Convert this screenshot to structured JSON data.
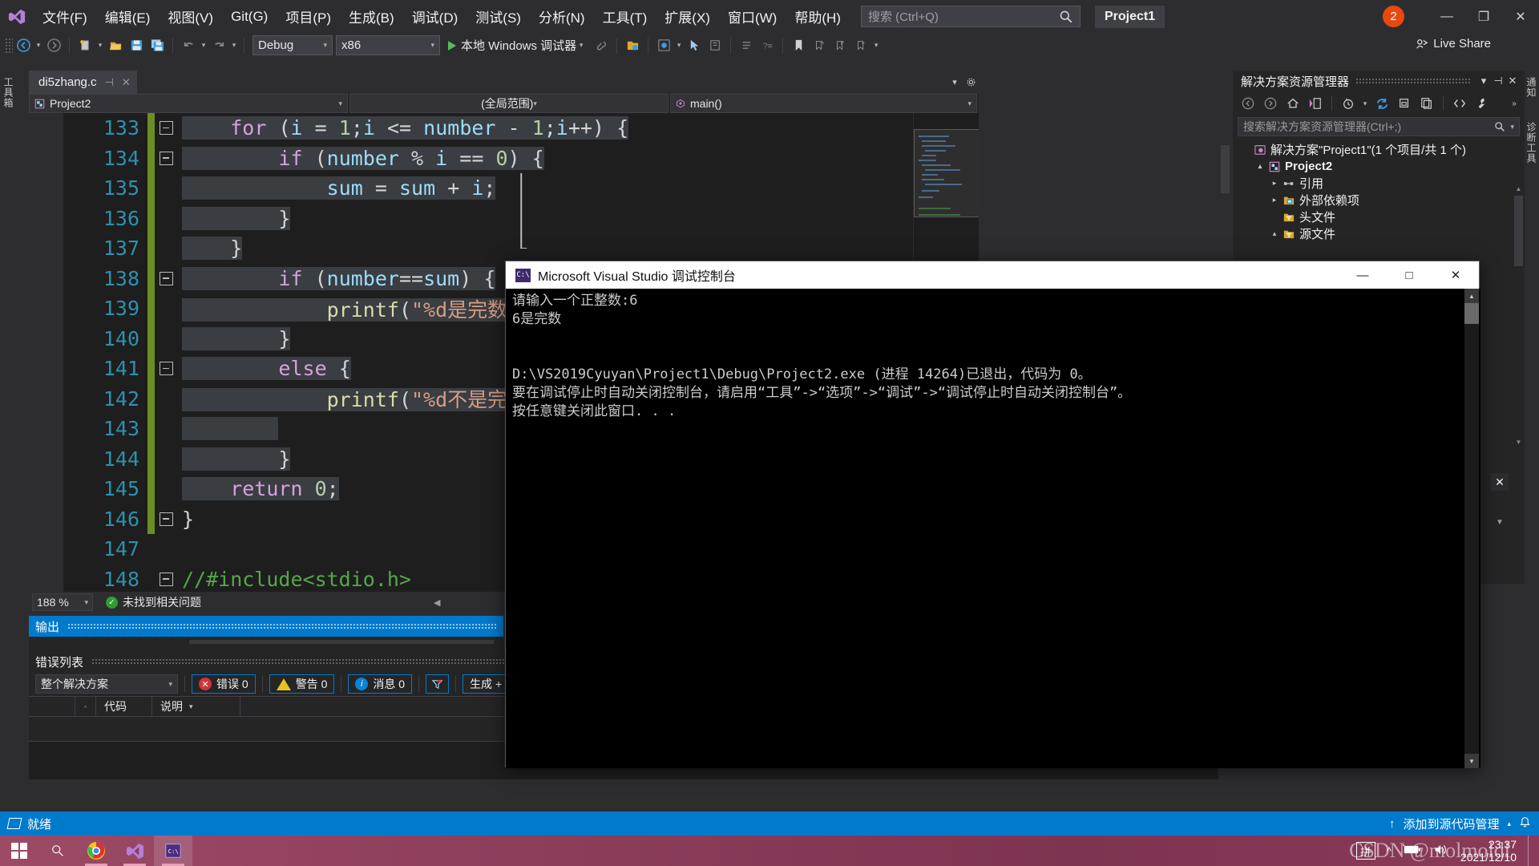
{
  "titlebar": {
    "menus": [
      {
        "label": "文件(F)"
      },
      {
        "label": "编辑(E)"
      },
      {
        "label": "视图(V)"
      },
      {
        "label": "Git(G)"
      },
      {
        "label": "项目(P)"
      },
      {
        "label": "生成(B)"
      },
      {
        "label": "调试(D)"
      },
      {
        "label": "测试(S)"
      },
      {
        "label": "分析(N)"
      },
      {
        "label": "工具(T)"
      },
      {
        "label": "扩展(X)"
      },
      {
        "label": "窗口(W)"
      },
      {
        "label": "帮助(H)"
      }
    ],
    "search_placeholder": "搜索 (Ctrl+Q)",
    "project_badge": "Project1",
    "notification_count": "2",
    "minimize": "—",
    "restore": "❐",
    "close": "✕"
  },
  "toolbar": {
    "config": "Debug",
    "platform": "x86",
    "run_label": "本地 Windows 调试器",
    "live_share": "Live Share"
  },
  "left_rail": {
    "label": "工具箱"
  },
  "right_rail": {
    "labels": [
      "通知",
      "诊断工具"
    ]
  },
  "editor": {
    "tab_name": "di5zhang.c",
    "tab_pin": "⊣",
    "tab_close": "✕",
    "nav_project": "Project2",
    "nav_scope": "(全局范围)",
    "nav_member": "main()",
    "zoom": "188 %",
    "issue_status": "未找到相关问题",
    "lines": [
      {
        "n": "133",
        "modified": true,
        "fold": "box",
        "html": "<span class=\"sel\">    <span class=\"kw\">for</span> <span class=\"pun\">(</span><span class=\"idf\">i</span> <span class=\"pun\">=</span> <span class=\"num\">1</span><span class=\"pun\">;</span><span class=\"idf\">i</span> <span class=\"pun\">&lt;=</span> <span class=\"idf\">number</span> <span class=\"pun\">-</span> <span class=\"num\">1</span><span class=\"pun\">;</span><span class=\"idf\">i</span><span class=\"pun\">++)</span> <span class=\"pun\">{</span></span>"
      },
      {
        "n": "134",
        "modified": true,
        "fold": "box",
        "html": "<span class=\"sel\">        <span class=\"kw\">if</span> <span class=\"pun\">(</span><span class=\"idf\">number</span> <span class=\"pun\">%</span> <span class=\"idf\">i</span> <span class=\"pun\">==</span> <span class=\"num\">0</span><span class=\"pun\">)</span> <span class=\"pun\">{</span></span>"
      },
      {
        "n": "135",
        "modified": true,
        "fold": "line",
        "html": "<span class=\"sel\">            <span class=\"idf\">sum</span> <span class=\"pun\">=</span> <span class=\"idf\">sum</span> <span class=\"pun\">+</span> <span class=\"idf\">i</span><span class=\"pun\">;</span></span>"
      },
      {
        "n": "136",
        "modified": true,
        "fold": "line",
        "html": "<span class=\"sel\">        <span class=\"pun\">}</span></span>"
      },
      {
        "n": "137",
        "modified": true,
        "fold": "corner",
        "html": "<span class=\"sel\">    <span class=\"pun\">}</span></span>"
      },
      {
        "n": "138",
        "modified": true,
        "fold": "box",
        "html": "<span class=\"sel\">        <span class=\"kw\">if</span> <span class=\"pun\">(</span><span class=\"idf\">number</span><span class=\"pun\">==</span><span class=\"idf\">sum</span><span class=\"pun\">)</span> <span class=\"pun\">{</span></span>"
      },
      {
        "n": "139",
        "modified": true,
        "fold": "line",
        "html": "<span class=\"sel\">            <span class=\"fn\">printf</span><span class=\"pun\">(</span><span class=\"str\">\"%d是完数\\n\"</span><span class=\"pun\">,</span> <span class=\"idf\">number</span><span class=\"pun\">);</span></span>"
      },
      {
        "n": "140",
        "modified": true,
        "fold": "line",
        "html": "<span class=\"sel\">        <span class=\"pun\">}</span></span>"
      },
      {
        "n": "141",
        "modified": true,
        "fold": "box",
        "html": "<span class=\"sel\">        <span class=\"kw\">else</span> <span class=\"pun\">{</span></span>"
      },
      {
        "n": "142",
        "modified": true,
        "fold": "line",
        "html": "<span class=\"sel\">            <span class=\"fn\">printf</span><span class=\"pun\">(</span><span class=\"str\">\"%d不是完数\\n\"</span><span class=\"pun\">,</span> <span class=\"idf\">number</span><span class=\"pun\">);</span></span>"
      },
      {
        "n": "143",
        "modified": true,
        "fold": "line",
        "html": "<span class=\"sel\">        </span>"
      },
      {
        "n": "144",
        "modified": true,
        "fold": "line",
        "html": "<span class=\"sel\">        <span class=\"pun\">}</span></span>"
      },
      {
        "n": "145",
        "modified": true,
        "fold": "corner",
        "html": "<span class=\"sel\">    <span class=\"kw\">return</span> <span class=\"num\">0</span><span class=\"pun\">;</span></span>"
      },
      {
        "n": "146",
        "modified": true,
        "fold": "endbox",
        "html": "<span class=\"pun\">}</span>"
      },
      {
        "n": "147",
        "modified": false,
        "fold": "none",
        "html": ""
      },
      {
        "n": "148",
        "modified": false,
        "fold": "box",
        "html": "<span class=\"cmt\">//#include&lt;stdio.h&gt;</span>"
      }
    ]
  },
  "output_panel": {
    "title": "输出"
  },
  "errorlist": {
    "title": "错误列表",
    "scope": "整个解决方案",
    "errors_label": "错误 0",
    "warnings_label": "警告 0",
    "messages_label": "消息 0",
    "filter_label": "生成 + In",
    "columns": [
      "",
      "",
      "代码",
      "说明"
    ]
  },
  "solution_explorer": {
    "title": "解决方案资源管理器",
    "caret": "▾",
    "pin": "⊣",
    "close": "✕",
    "search_placeholder": "搜索解决方案资源管理器(Ctrl+;)",
    "tree": [
      {
        "indent": 0,
        "twisty": "",
        "icon": "solution",
        "label": "解决方案\"Project1\"(1 个项目/共 1 个)",
        "bold": false
      },
      {
        "indent": 1,
        "twisty": "▴",
        "icon": "project",
        "label": "Project2",
        "bold": true
      },
      {
        "indent": 2,
        "twisty": "▸",
        "icon": "reference",
        "label": "引用",
        "bold": false
      },
      {
        "indent": 2,
        "twisty": "▸",
        "icon": "folder-blue",
        "label": "外部依赖项",
        "bold": false
      },
      {
        "indent": 2,
        "twisty": "",
        "icon": "filter",
        "label": "头文件",
        "bold": false
      },
      {
        "indent": 2,
        "twisty": "▴",
        "icon": "filter",
        "label": "源文件",
        "bold": false
      }
    ]
  },
  "console": {
    "title": "Microsoft Visual Studio 调试控制台",
    "icon_text": "C:\\",
    "minimize": "—",
    "maximize": "□",
    "close": "✕",
    "output": "请输入一个正整数:6\n6是完数\n\n\nD:\\VS2019Cyuyan\\Project1\\Debug\\Project2.exe (进程 14264)已退出，代码为 0。\n要在调试停止时自动关闭控制台，请启用“工具”->“选项”->“调试”->“调试停止时自动关闭控制台”。\n按任意键关闭此窗口. . ."
  },
  "statusbar": {
    "status": "就绪",
    "source_control": "添加到源代码管理",
    "up_arrow": "↑",
    "caret": "▴",
    "bell": "🔔"
  },
  "taskbar": {
    "items": [
      {
        "name": "start",
        "label": ""
      },
      {
        "name": "search",
        "label": ""
      },
      {
        "name": "chrome",
        "label": ""
      },
      {
        "name": "visual-studio",
        "label": ""
      },
      {
        "name": "console-window",
        "label": ""
      }
    ],
    "ime": "拼",
    "time": "23:37",
    "date": "2021/12/10",
    "watermark": "CSDN @molmoldl"
  }
}
